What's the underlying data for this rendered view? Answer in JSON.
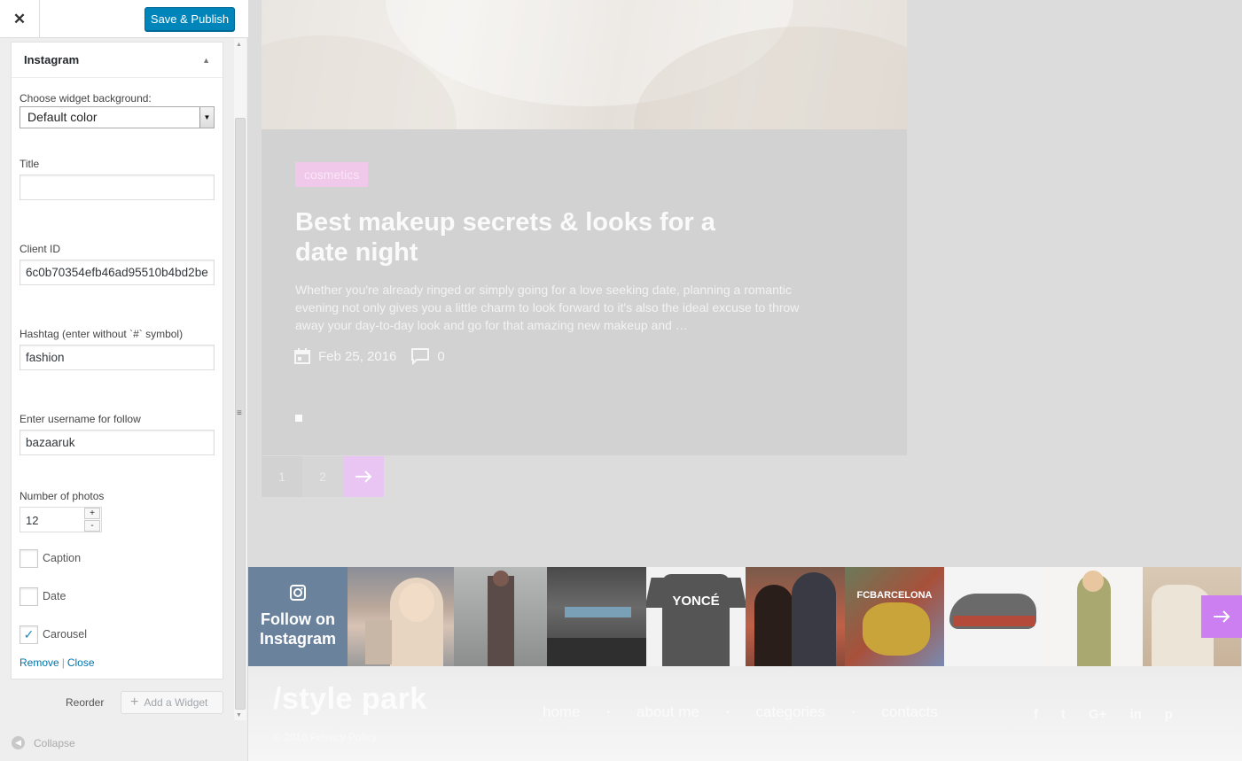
{
  "sidebar": {
    "close_icon": "close-icon",
    "publish_label": "Save & Publish",
    "widget": {
      "title": "Instagram",
      "background_label": "Choose widget background:",
      "background_value": "Default color",
      "title_label": "Title",
      "title_value": "",
      "client_id_label": "Client ID",
      "client_id_value": "6c0b70354efb46ad95510b4bd2be",
      "hashtag_label": "Hashtag (enter without `#` symbol)",
      "hashtag_value": "fashion",
      "username_label": "Enter username for follow",
      "username_value": "bazaaruk",
      "photos_label": "Number of photos",
      "photos_value": "12",
      "stepper_up": "+",
      "stepper_down": "-",
      "checkboxes": [
        {
          "label": "Caption",
          "checked": false
        },
        {
          "label": "Date",
          "checked": false
        },
        {
          "label": "Carousel",
          "checked": true
        }
      ],
      "remove_label": "Remove",
      "separator": "|",
      "close_label": "Close"
    },
    "reorder_label": "Reorder",
    "add_widget_label": "Add a Widget",
    "collapse_label": "Collapse"
  },
  "post": {
    "category": "cosmetics",
    "title": "Best makeup secrets & looks for a date night",
    "excerpt": "Whether you're already ringed or simply going for a love seeking date, planning a romantic evening not only gives you a little charm to look forward to it's also the ideal excuse to throw away your day-to-day look and go for that amazing new makeup and …",
    "date": "Feb 25, 2016",
    "comments": "0"
  },
  "pagination": {
    "pages": [
      "1",
      "2"
    ],
    "next_icon": "arrow-right-icon"
  },
  "instagram": {
    "follow_text": "Follow on Instagram",
    "tshirt_text": "YONCÉ",
    "jersey_text": "FCBARCELONA"
  },
  "footer": {
    "logo": "/style park",
    "copyright": "© 2016 Privacy Policy",
    "nav": [
      "home",
      "about me",
      "categories",
      "contacts"
    ],
    "nav_separator": "•",
    "social": [
      "f",
      "t",
      "G+",
      "in",
      "p"
    ]
  },
  "colors": {
    "publish": "#0085ba",
    "accent": "#cc7ff0",
    "category_bg": "#f0c8ea",
    "link": "#0073aa"
  }
}
